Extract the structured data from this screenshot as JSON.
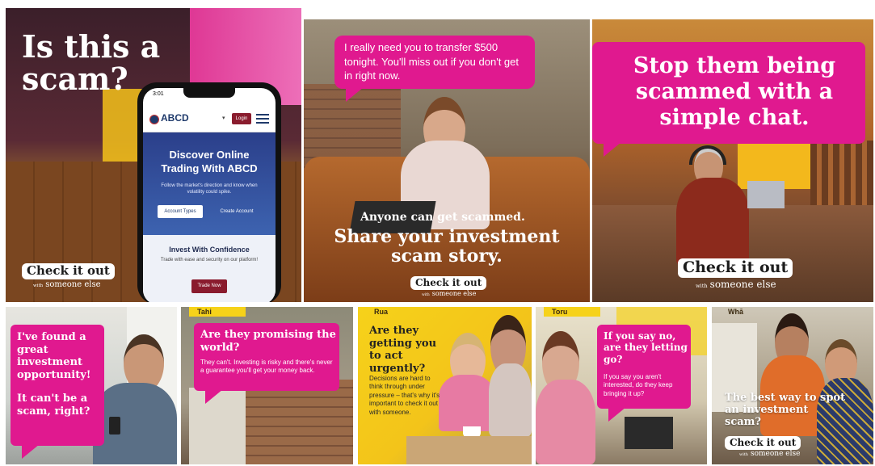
{
  "colors": {
    "pink": "#e0198f",
    "yellow": "#f6d21a",
    "maroon": "#8a1c2e",
    "navy": "#1f3a6b"
  },
  "panel1": {
    "headline": "Is this a scam?",
    "phone": {
      "time": "3:01",
      "brand": "ABCD",
      "login": "Login",
      "hero_title": "Discover Online Trading With ABCD",
      "hero_text": "Follow the market's direction and know when volatility could spike.",
      "btn_account_types": "Account Types",
      "btn_create_account": "Create Account",
      "card_title": "Invest With Confidence",
      "card_text": "Trade with ease and security on our platform!",
      "btn_trade_now": "Trade Now"
    },
    "logo_main": "Check it out",
    "logo_with": "with",
    "logo_sub": "someone else"
  },
  "panel2": {
    "bubble": "I really need you to transfer $500 tonight. You'll miss out if you don't get in right now.",
    "kicker": "Anyone can get scammed.",
    "headline": "Share your investment scam story.",
    "logo_main": "Check it out",
    "logo_with": "with",
    "logo_sub": "someone else"
  },
  "panel3": {
    "headline": "Stop them being scammed with a simple chat.",
    "logo_main": "Check it out",
    "logo_with": "with",
    "logo_sub": "someone else"
  },
  "panel4": {
    "bubble_line1": "I've found a great investment opportunity!",
    "bubble_line2": "It can't be a scam, right?"
  },
  "panel5": {
    "name": "Tahi",
    "title": "Are they promising the world?",
    "body": "They can't. Investing is risky and there's never a guarantee you'll get your money back."
  },
  "panel6": {
    "name": "Rua",
    "title": "Are they getting you to act urgently?",
    "body": "Decisions are hard to think through under pressure – that's why it's important to check it out with someone."
  },
  "panel7": {
    "name": "Toru",
    "title": "If you say no, are they letting go?",
    "body": "If you say you aren't interested, do they keep bringing it up?"
  },
  "panel8": {
    "name": "Whā",
    "headline": "The best way to spot an investment scam?",
    "logo_main": "Check it out",
    "logo_with": "with",
    "logo_sub": "someone else"
  }
}
